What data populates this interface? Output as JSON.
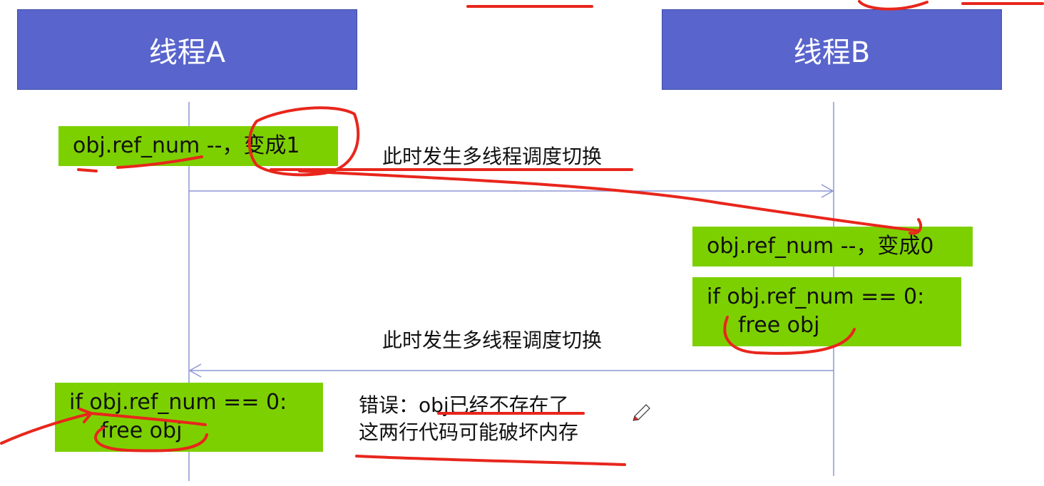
{
  "threads": {
    "a": {
      "title": "线程A"
    },
    "b": {
      "title": "线程B"
    }
  },
  "steps": {
    "a_decrement": "obj.ref_num --，变成1",
    "b_decrement": "obj.ref_num --，变成0",
    "b_check": {
      "line1": "if obj.ref_num == 0:",
      "line2": "free obj"
    },
    "a_check": {
      "line1": "if obj.ref_num == 0:",
      "line2": "free obj"
    }
  },
  "switch_notes": {
    "first": "此时发生多线程调度切换",
    "second": "此时发生多线程调度切换"
  },
  "error_note": {
    "line1": "错误：obj已经不存在了",
    "line2": "这两行代码可能破坏内存"
  },
  "colors": {
    "header": "#5965cc",
    "step_box": "#7dd000",
    "lifeline": "#8d96d6",
    "annotation": "#e8261c"
  }
}
